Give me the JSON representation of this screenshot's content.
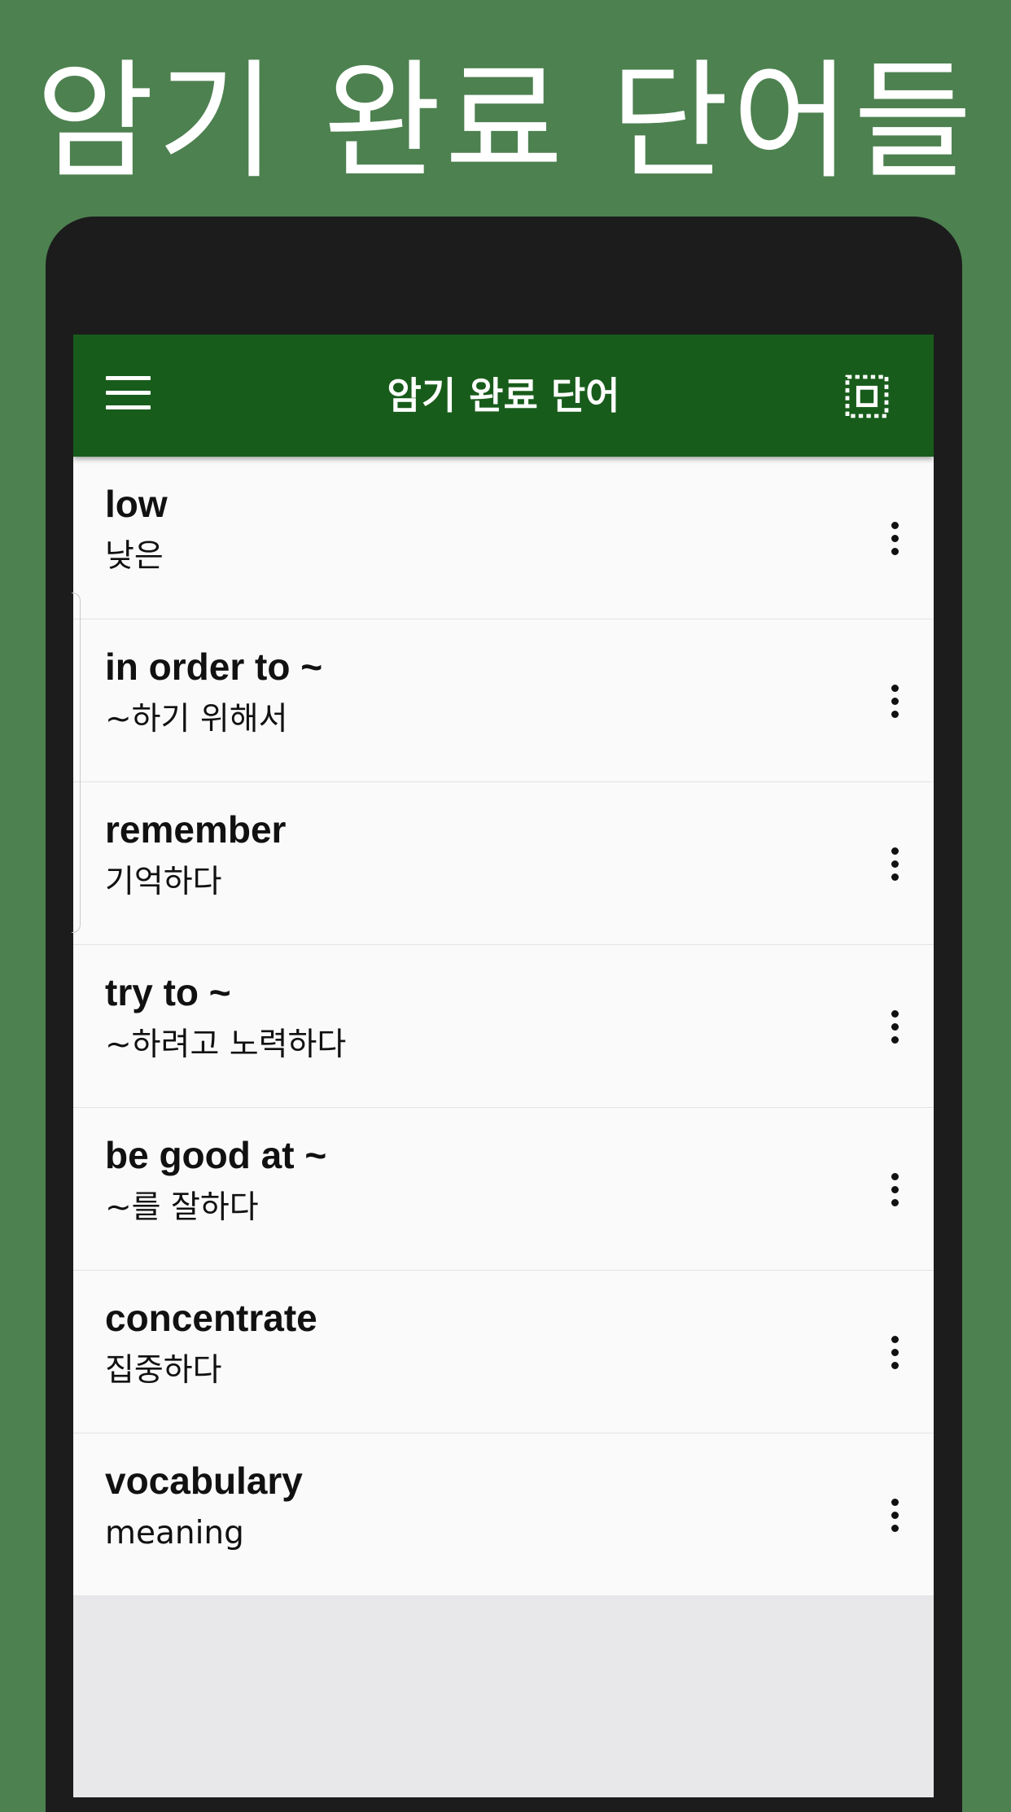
{
  "banner": {
    "headline": "암기 완료 단어들"
  },
  "appbar": {
    "title": "암기 완료 단어",
    "menu_icon": "hamburger-menu-icon",
    "select_icon": "select-all-icon"
  },
  "colors": {
    "background": "#4d8150",
    "appbar": "#185c1b",
    "list_item": "#fafafa",
    "screen_empty": "#e8e8ea",
    "phone_frame": "#1c1c1c"
  },
  "words": [
    {
      "word": "low",
      "meaning": "낮은"
    },
    {
      "word": "in order to ~",
      "meaning": "~하기 위해서"
    },
    {
      "word": "remember",
      "meaning": "기억하다"
    },
    {
      "word": "try to ~",
      "meaning": "~하려고 노력하다"
    },
    {
      "word": "be good at ~",
      "meaning": "~를 잘하다"
    },
    {
      "word": "concentrate",
      "meaning": "집중하다"
    },
    {
      "word": "vocabulary",
      "meaning": "meaning"
    }
  ]
}
